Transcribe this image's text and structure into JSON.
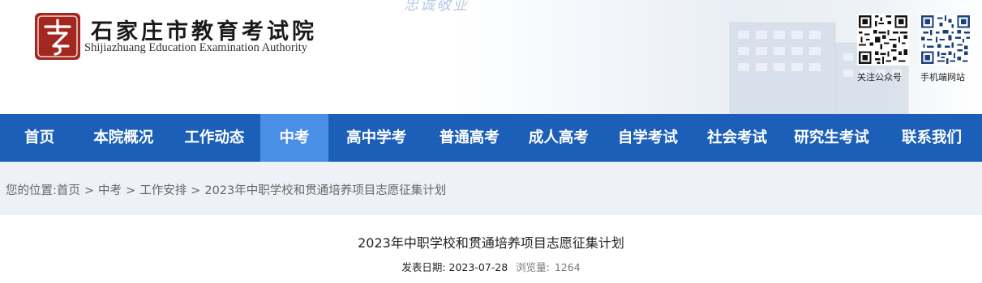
{
  "header": {
    "slogan": "忠诚敬业",
    "title_cn": "石家庄市教育考试院",
    "title_en": "Shijiazhuang Education Examination Authority",
    "logo_mark": "考",
    "qr_codes": [
      {
        "label": "关注公众号"
      },
      {
        "label": "手机端网站"
      }
    ]
  },
  "nav": {
    "items": [
      {
        "label": "首页"
      },
      {
        "label": "本院概况"
      },
      {
        "label": "工作动态"
      },
      {
        "label": "中考",
        "active": true
      },
      {
        "label": "高中学考"
      },
      {
        "label": "普通高考"
      },
      {
        "label": "成人高考"
      },
      {
        "label": "自学考试"
      },
      {
        "label": "社会考试"
      },
      {
        "label": "研究生考试"
      },
      {
        "label": "联系我们"
      }
    ]
  },
  "breadcrumb": {
    "prefix": "您的位置:",
    "items": [
      "首页",
      "中考",
      "工作安排"
    ],
    "separator": ">",
    "current": "2023年中职学校和贯通培养项目志愿征集计划"
  },
  "article": {
    "title": "2023年中职学校和贯通培养项目志愿征集计划",
    "date_label": "发表日期:",
    "date": "2023-07-28",
    "views_label": "浏览量:",
    "views": "1264"
  },
  "colors": {
    "nav_bg": "#1b5fb9",
    "nav_active": "#4a8fe6",
    "logo_red": "#a3261f",
    "breadcrumb_bg": "#eef1f7"
  }
}
